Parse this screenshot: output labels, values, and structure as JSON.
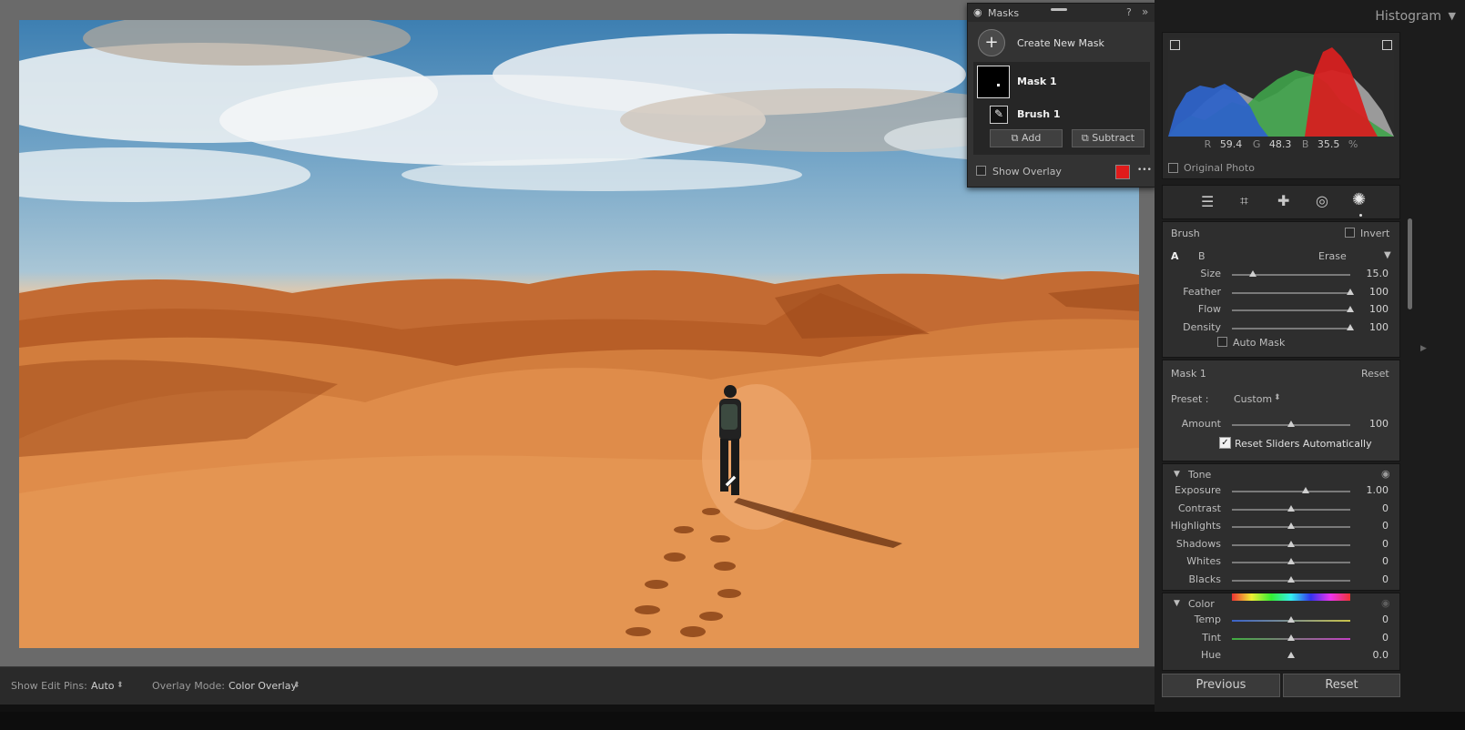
{
  "colors": {
    "accent_red": "#e01b1b",
    "panel_bg": "#2e2e2e",
    "app_bg": "#1b1b1b"
  },
  "masks": {
    "title": "Masks",
    "create_new": "Create New Mask",
    "mask_name": "Mask 1",
    "brush_name": "Brush 1",
    "add_label": "Add",
    "subtract_label": "Subtract",
    "show_overlay": "Show Overlay",
    "overlay_color": "#e01b1b",
    "more": "•••"
  },
  "histogram": {
    "title": "Histogram",
    "r_label": "R",
    "r_value": "59.4",
    "g_label": "G",
    "g_value": "48.3",
    "b_label": "B",
    "b_value": "35.5",
    "percent": "%",
    "original_photo": "Original Photo"
  },
  "tools": [
    "sliders-icon",
    "crop-icon",
    "heal-icon",
    "redeye-icon",
    "mask-icon"
  ],
  "brush": {
    "title": "Brush",
    "invert": "Invert",
    "tab_a": "A",
    "tab_b": "B",
    "erase": "Erase",
    "sliders": [
      {
        "label": "Size",
        "value": "15.0",
        "pos": 0.18
      },
      {
        "label": "Feather",
        "value": "100",
        "pos": 1.0
      },
      {
        "label": "Flow",
        "value": "100",
        "pos": 1.0
      },
      {
        "label": "Density",
        "value": "100",
        "pos": 1.0
      }
    ],
    "auto_mask": "Auto Mask"
  },
  "mask_section": {
    "title": "Mask 1",
    "reset": "Reset",
    "preset_label": "Preset :",
    "preset_value": "Custom",
    "amount_label": "Amount",
    "amount_value": "100",
    "amount_pos": 0.5,
    "reset_sliders": "Reset Sliders Automatically"
  },
  "tone": {
    "title": "Tone",
    "sliders": [
      {
        "label": "Exposure",
        "value": "1.00",
        "pos": 0.62
      },
      {
        "label": "Contrast",
        "value": "0",
        "pos": 0.5
      },
      {
        "label": "Highlights",
        "value": "0",
        "pos": 0.5
      },
      {
        "label": "Shadows",
        "value": "0",
        "pos": 0.5
      },
      {
        "label": "Whites",
        "value": "0",
        "pos": 0.5
      },
      {
        "label": "Blacks",
        "value": "0",
        "pos": 0.5
      }
    ]
  },
  "color": {
    "title": "Color",
    "sliders": [
      {
        "label": "Temp",
        "value": "0",
        "pos": 0.5
      },
      {
        "label": "Tint",
        "value": "0",
        "pos": 0.5
      },
      {
        "label": "Hue",
        "value": "0.0",
        "pos": 0.5
      }
    ]
  },
  "footer": {
    "previous": "Previous",
    "reset": "Reset"
  },
  "bottom_bar": {
    "edit_pins_label": "Show Edit Pins:",
    "edit_pins_value": "Auto",
    "overlay_mode_label": "Overlay Mode:",
    "overlay_mode_value": "Color Overlay"
  }
}
